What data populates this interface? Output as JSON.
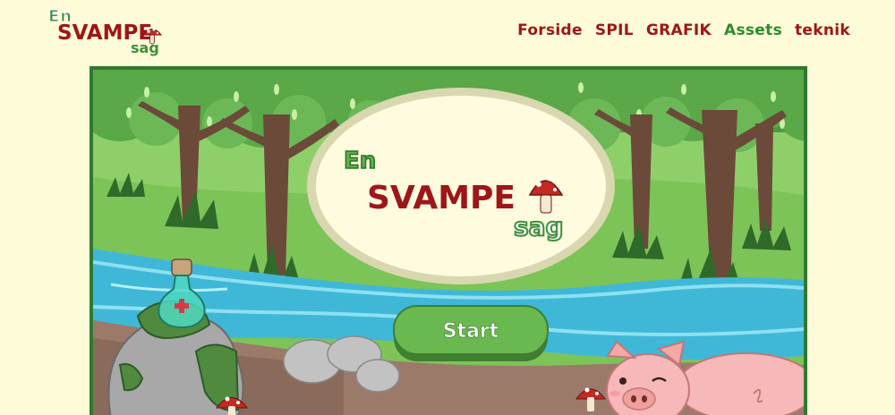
{
  "brand": {
    "en": "En",
    "svampe": "SVAMPE",
    "sag": "sag"
  },
  "nav": {
    "items": [
      {
        "label": "Forside",
        "active": false
      },
      {
        "label": "SPIL",
        "active": false
      },
      {
        "label": "GRAFIK",
        "active": false
      },
      {
        "label": "Assets",
        "active": true
      },
      {
        "label": "teknik",
        "active": false
      }
    ]
  },
  "game": {
    "title_en": "En",
    "title_svampe": "SVAMPE",
    "title_sag": "sag",
    "start_label": "Start"
  },
  "colors": {
    "background": "#fefbd8",
    "brand_red": "#9e1618",
    "brand_green": "#3e8f3a",
    "nav_active": "#2e8b2e",
    "frame": "#2f7a30"
  },
  "icons": {
    "mushroom": "mushroom-icon",
    "potion": "potion-icon",
    "pig": "pig-icon"
  }
}
